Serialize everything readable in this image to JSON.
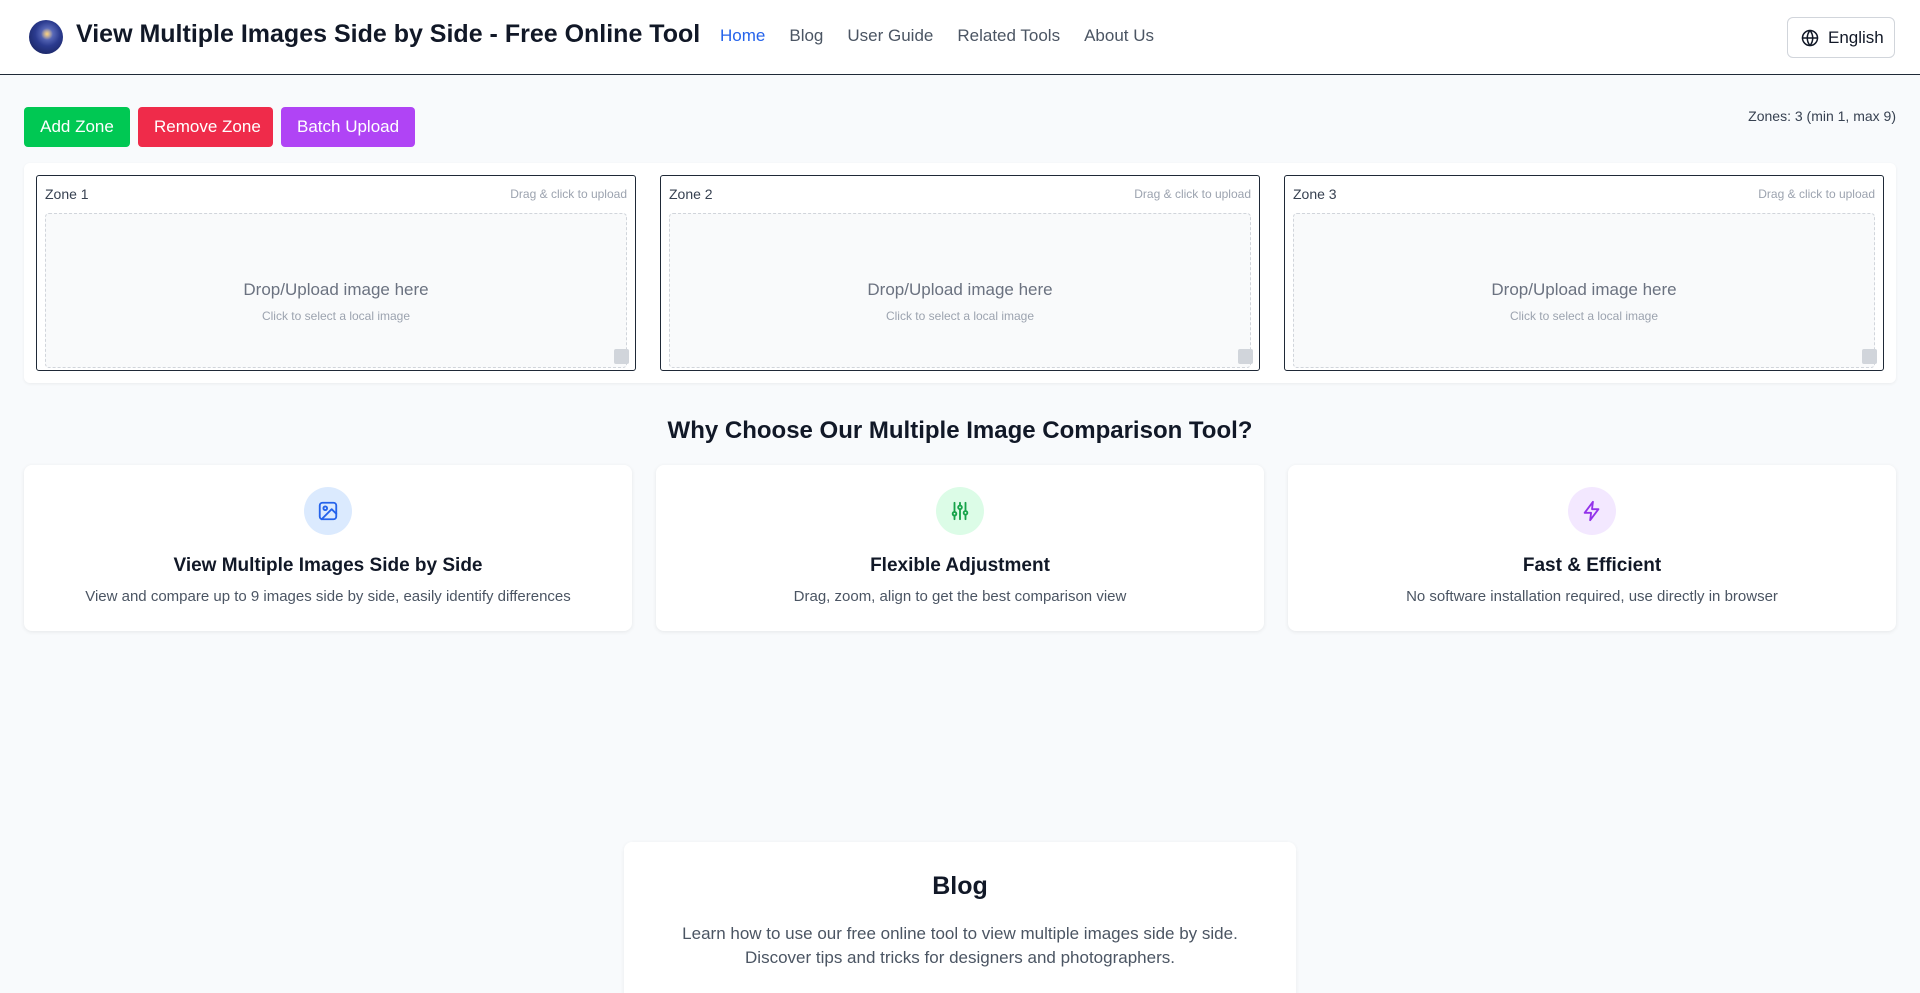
{
  "header": {
    "title": "View Multiple Images Side by Side - Free Online Tool",
    "nav": [
      "Home",
      "Blog",
      "User Guide",
      "Related Tools",
      "About Us"
    ],
    "active_nav": "Home",
    "language": "English"
  },
  "toolbar": {
    "add_label": "Add Zone",
    "remove_label": "Remove Zone",
    "batch_label": "Batch Upload",
    "zones_info": "Zones: 3 (min 1, max 9)"
  },
  "zones": [
    {
      "title": "Zone 1",
      "hint": "Drag & click to upload",
      "main": "Drop/Upload image here",
      "sub": "Click to select a local image"
    },
    {
      "title": "Zone 2",
      "hint": "Drag & click to upload",
      "main": "Drop/Upload image here",
      "sub": "Click to select a local image"
    },
    {
      "title": "Zone 3",
      "hint": "Drag & click to upload",
      "main": "Drop/Upload image here",
      "sub": "Click to select a local image"
    }
  ],
  "why": {
    "title": "Why Choose Our Multiple Image Comparison Tool?",
    "features": [
      {
        "icon": "image-icon",
        "title": "View Multiple Images Side by Side",
        "desc": "View and compare up to 9 images side by side, easily identify differences",
        "color": "#2563eb",
        "bg": "#dbeafe"
      },
      {
        "icon": "sliders-icon",
        "title": "Flexible Adjustment",
        "desc": "Drag, zoom, align to get the best comparison view",
        "color": "#16a34a",
        "bg": "#dcfce7"
      },
      {
        "icon": "lightning-icon",
        "title": "Fast & Efficient",
        "desc": "No software installation required, use directly in browser",
        "color": "#9333ea",
        "bg": "#f3e8ff"
      }
    ]
  },
  "blog": {
    "title": "Blog",
    "desc_line1": "Learn how to use our free online tool to view multiple images side by side.",
    "desc_line2": "Discover tips and tricks for designers and photographers."
  },
  "colors": {
    "accent": "#2563eb",
    "add": "#00c853",
    "remove": "#ef2b4a",
    "batch": "#b044f5"
  }
}
